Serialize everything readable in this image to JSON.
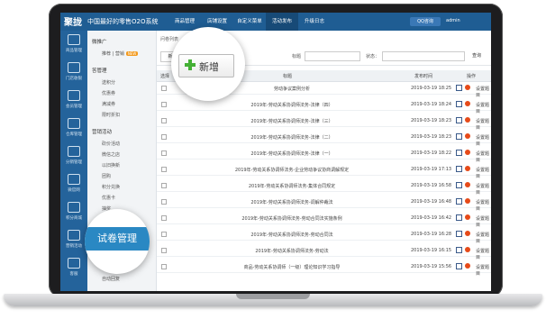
{
  "header": {
    "logo": "聚拢",
    "slogan": "中国最好的零售O2O系统",
    "nav": [
      "商品管理",
      "店铺设置",
      "自定义菜单",
      "活动发布",
      "升级日志"
    ],
    "active_nav": 3,
    "qq_button": "QQ咨询",
    "user": "admin"
  },
  "left_sidebar": [
    {
      "label": "商品管理"
    },
    {
      "label": "门店收银"
    },
    {
      "label": "会员管理"
    },
    {
      "label": "仓库管理"
    },
    {
      "label": "分销管理"
    },
    {
      "label": "微官网"
    },
    {
      "label": "积分商城"
    },
    {
      "label": "营销活动"
    },
    {
      "label": "客服"
    }
  ],
  "submenu": {
    "sections": [
      {
        "title": "微推广",
        "items": [
          {
            "label": "推荐 | 营销",
            "badge": "NEW"
          }
        ]
      },
      {
        "title": "答管理",
        "items": [
          {
            "label": "送积分"
          },
          {
            "label": "优惠券"
          },
          {
            "label": "满减券"
          },
          {
            "label": "限时折扣"
          }
        ]
      },
      {
        "title": "营销活动",
        "items": [
          {
            "label": "砍价活动"
          },
          {
            "label": "微信之店"
          },
          {
            "label": "以旧换新"
          },
          {
            "label": "团购"
          },
          {
            "label": "积分兑换"
          },
          {
            "label": "优惠卡"
          },
          {
            "label": "抽奖"
          }
        ]
      }
    ],
    "footer_item": "自动回复"
  },
  "main": {
    "breadcrumb": "问卷列表",
    "toolbar": {
      "add_label": "新",
      "title_label": "标题",
      "status_label": "状态：",
      "search_label": "查询"
    },
    "table": {
      "headers": [
        "选择",
        "标题",
        "发布时间",
        "操作"
      ],
      "settings_label": "设置题目",
      "rows": [
        {
          "title": "劳动争议案例分析",
          "date": "2019-03-19 18:25"
        },
        {
          "title": "2019年-劳动关系协调师法务-法律（四）",
          "date": "2019-03-19 18:24"
        },
        {
          "title": "2019年-劳动关系协调师法务-法律（三）",
          "date": "2019-03-19 18:23"
        },
        {
          "title": "2019年-劳动关系协调师法务-法律（二）",
          "date": "2019-03-19 18:23"
        },
        {
          "title": "2019年-劳动关系协调师法务-法律（一）",
          "date": "2019-03-19 18:22"
        },
        {
          "title": "2019年-劳动关系协调师法务-企业劳动争议协商调解规定",
          "date": "2019-03-19 17:13"
        },
        {
          "title": "2019年-劳动关系协调师法务-集体合同规定",
          "date": "2019-03-19 16:58"
        },
        {
          "title": "2019年-劳动关系协调师法务-调解仲裁法",
          "date": "2019-03-19 16:48"
        },
        {
          "title": "2019年-劳动关系协调师法务-劳动合同法实施条例",
          "date": "2019-03-19 16:42"
        },
        {
          "title": "2019年-劳动关系协调师法务-劳动合同法",
          "date": "2019-03-19 16:28"
        },
        {
          "title": "2019年-劳动关系协调师法务-劳动法",
          "date": "2019-03-19 16:15"
        },
        {
          "title": "商品-劳动关系协调师（一级）理论知识学习指导",
          "date": "2019-03-19 15:56"
        }
      ]
    }
  },
  "magnifier_add": {
    "label": "新增"
  },
  "magnifier_tag": {
    "label": "试卷管理"
  },
  "colors": {
    "header": "#1f5d93",
    "sidebar": "#24639b",
    "accent": "#2a88c3",
    "add_plus": "#44b035",
    "delete": "#e64a19"
  }
}
